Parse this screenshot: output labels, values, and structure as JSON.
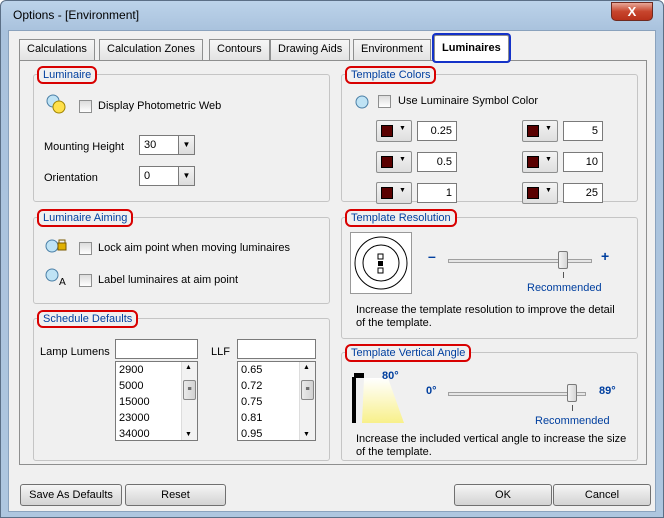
{
  "window": {
    "title": "Options - [Environment]",
    "close_glyph": "X"
  },
  "tabs": [
    {
      "label": "Calculations",
      "active": false
    },
    {
      "label": "Calculation Zones",
      "active": false
    },
    {
      "label": "Contours",
      "active": false
    },
    {
      "label": "Drawing Aids",
      "active": false
    },
    {
      "label": "Environment",
      "active": false
    },
    {
      "label": "Luminaires",
      "active": true
    }
  ],
  "luminaire": {
    "heading": "Luminaire",
    "display_web_label": "Display Photometric Web",
    "display_web_checked": false,
    "mounting_height_label": "Mounting Height",
    "mounting_height_value": "30",
    "orientation_label": "Orientation",
    "orientation_value": "0"
  },
  "aiming": {
    "heading": "Luminaire Aiming",
    "lock_label": "Lock aim point when moving luminaires",
    "lock_checked": false,
    "label_label": "Label luminaires at aim point",
    "label_checked": false
  },
  "schedule": {
    "heading": "Schedule Defaults",
    "lamp_lumens_label": "Lamp Lumens",
    "lamp_lumens_input": "",
    "lumens": [
      "2900",
      "5000",
      "15000",
      "23000",
      "34000"
    ],
    "llf_label": "LLF",
    "llf_input": "",
    "llf": [
      "0.65",
      "0.72",
      "0.75",
      "0.81",
      "0.95"
    ]
  },
  "template_colors": {
    "heading": "Template Colors",
    "symbol_color_label": "Use Luminaire Symbol Color",
    "symbol_color_checked": false,
    "swatch_color": "#5a0000",
    "left_values": [
      "0.25",
      "0.5",
      "1"
    ],
    "right_values": [
      "5",
      "10",
      "25"
    ]
  },
  "template_resolution": {
    "heading": "Template Resolution",
    "minus": "–",
    "plus": "+",
    "level": 0.8,
    "recommended_label": "Recommended",
    "help": "Increase the template resolution to improve the detail of the template."
  },
  "template_vertical_angle": {
    "heading": "Template Vertical Angle",
    "icon_angle": "80°",
    "min_label": "0°",
    "max_label": "89°",
    "level": 0.9,
    "recommended_label": "Recommended",
    "help": "Increase the included vertical angle to increase the size of the template."
  },
  "buttons": {
    "save_defaults": "Save As Defaults",
    "reset": "Reset",
    "ok": "OK",
    "cancel": "Cancel"
  },
  "colors": {
    "heading_text": "#003f9f",
    "highlight_ring": "#d80000",
    "active_tab_ring": "#1432c8"
  }
}
